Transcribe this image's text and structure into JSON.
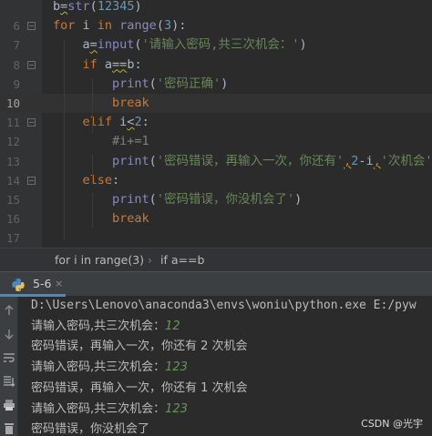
{
  "editor": {
    "line_numbers": [
      "",
      "6",
      "7",
      "8",
      "9",
      "10",
      "11",
      "12",
      "13",
      "14",
      "15",
      "16",
      "17"
    ],
    "current_line_index": 5,
    "lines": [
      [
        {
          "t": "b",
          "c": "p"
        },
        {
          "t": "=",
          "c": "p",
          "sq": true
        },
        {
          "t": "str",
          "c": "bi"
        },
        {
          "t": "(",
          "c": "p"
        },
        {
          "t": "12345",
          "c": "num"
        },
        {
          "t": ")",
          "c": "p"
        }
      ],
      [
        {
          "t": "for ",
          "c": "kw"
        },
        {
          "t": "i ",
          "c": "p"
        },
        {
          "t": "in ",
          "c": "kw"
        },
        {
          "t": "range",
          "c": "bi"
        },
        {
          "t": "(",
          "c": "p"
        },
        {
          "t": "3",
          "c": "num"
        },
        {
          "t": "):",
          "c": "p"
        }
      ],
      [
        {
          "t": "    a",
          "c": "p"
        },
        {
          "t": "=",
          "c": "p",
          "sq": true
        },
        {
          "t": "input",
          "c": "bi"
        },
        {
          "t": "(",
          "c": "p"
        },
        {
          "t": "'请输入密码,共三次机会：'",
          "c": "str"
        },
        {
          "t": ")",
          "c": "p"
        }
      ],
      [
        {
          "t": "    ",
          "c": "p"
        },
        {
          "t": "if ",
          "c": "kw"
        },
        {
          "t": "a",
          "c": "p"
        },
        {
          "t": "==",
          "c": "p",
          "sq": true
        },
        {
          "t": "b:",
          "c": "p"
        }
      ],
      [
        {
          "t": "        ",
          "c": "p"
        },
        {
          "t": "print",
          "c": "bi"
        },
        {
          "t": "(",
          "c": "p"
        },
        {
          "t": "'密码正确'",
          "c": "str"
        },
        {
          "t": ")",
          "c": "p"
        }
      ],
      [
        {
          "t": "        ",
          "c": "p"
        },
        {
          "t": "break",
          "c": "kw"
        }
      ],
      [
        {
          "t": "    ",
          "c": "p"
        },
        {
          "t": "elif ",
          "c": "kw"
        },
        {
          "t": "i",
          "c": "p"
        },
        {
          "t": "<",
          "c": "p",
          "sq": true
        },
        {
          "t": "2",
          "c": "num"
        },
        {
          "t": ":",
          "c": "p"
        }
      ],
      [
        {
          "t": "        ",
          "c": "p"
        },
        {
          "t": "#i+=1",
          "c": "cmt"
        }
      ],
      [
        {
          "t": "        ",
          "c": "p"
        },
        {
          "t": "print",
          "c": "bi"
        },
        {
          "t": "(",
          "c": "p"
        },
        {
          "t": "'密码错误，再输入一次，你还有'",
          "c": "str"
        },
        {
          "t": ",",
          "c": "kw",
          "sq": true
        },
        {
          "t": "2",
          "c": "num"
        },
        {
          "t": "-i",
          "c": "p"
        },
        {
          "t": ",",
          "c": "kw",
          "sq": true
        },
        {
          "t": "'次机会'",
          "c": "str"
        },
        {
          "t": ")",
          "c": "p"
        }
      ],
      [
        {
          "t": "    ",
          "c": "p"
        },
        {
          "t": "else",
          "c": "kw"
        },
        {
          "t": ":",
          "c": "p"
        }
      ],
      [
        {
          "t": "        ",
          "c": "p"
        },
        {
          "t": "print",
          "c": "bi"
        },
        {
          "t": "(",
          "c": "p"
        },
        {
          "t": "'密码错误，你没机会了'",
          "c": "str"
        },
        {
          "t": ")",
          "c": "p"
        }
      ],
      [
        {
          "t": "        ",
          "c": "p"
        },
        {
          "t": "break",
          "c": "kw"
        }
      ],
      []
    ]
  },
  "breadcrumb": {
    "items": [
      "for i in range(3)",
      "if a==b"
    ],
    "separator": "›"
  },
  "run_panel": {
    "tab_label": "5-6",
    "close_glyph": "×",
    "toolbar_icons": [
      "arrow-up-icon",
      "arrow-down-icon",
      "soft-wrap-icon",
      "scroll-to-end-icon",
      "print-icon",
      "trash-icon"
    ]
  },
  "console": {
    "lines": [
      {
        "text": "D:\\Users\\Lenovo\\anaconda3\\envs\\woniu\\python.exe E:/pyw",
        "mono": true
      },
      {
        "text": "请输入密码,共三次机会：",
        "input": "12"
      },
      {
        "text": "密码错误，再输入一次，你还有 2 次机会"
      },
      {
        "text": "请输入密码,共三次机会：",
        "input": "123"
      },
      {
        "text": "密码错误，再输入一次，你还有 1 次机会"
      },
      {
        "text": "请输入密码,共三次机会：",
        "input": "123"
      },
      {
        "text": "密码错误，你没机会了"
      }
    ]
  },
  "watermark": "CSDN @光宇",
  "colors": {
    "editor_bg": "#2b2b2b",
    "keyword": "#cc7832",
    "builtin": "#8888c6",
    "number": "#6897bb",
    "string": "#6a8759",
    "comment": "#808080",
    "user_input": "#629755",
    "tab_underline": "#4a88c7"
  }
}
